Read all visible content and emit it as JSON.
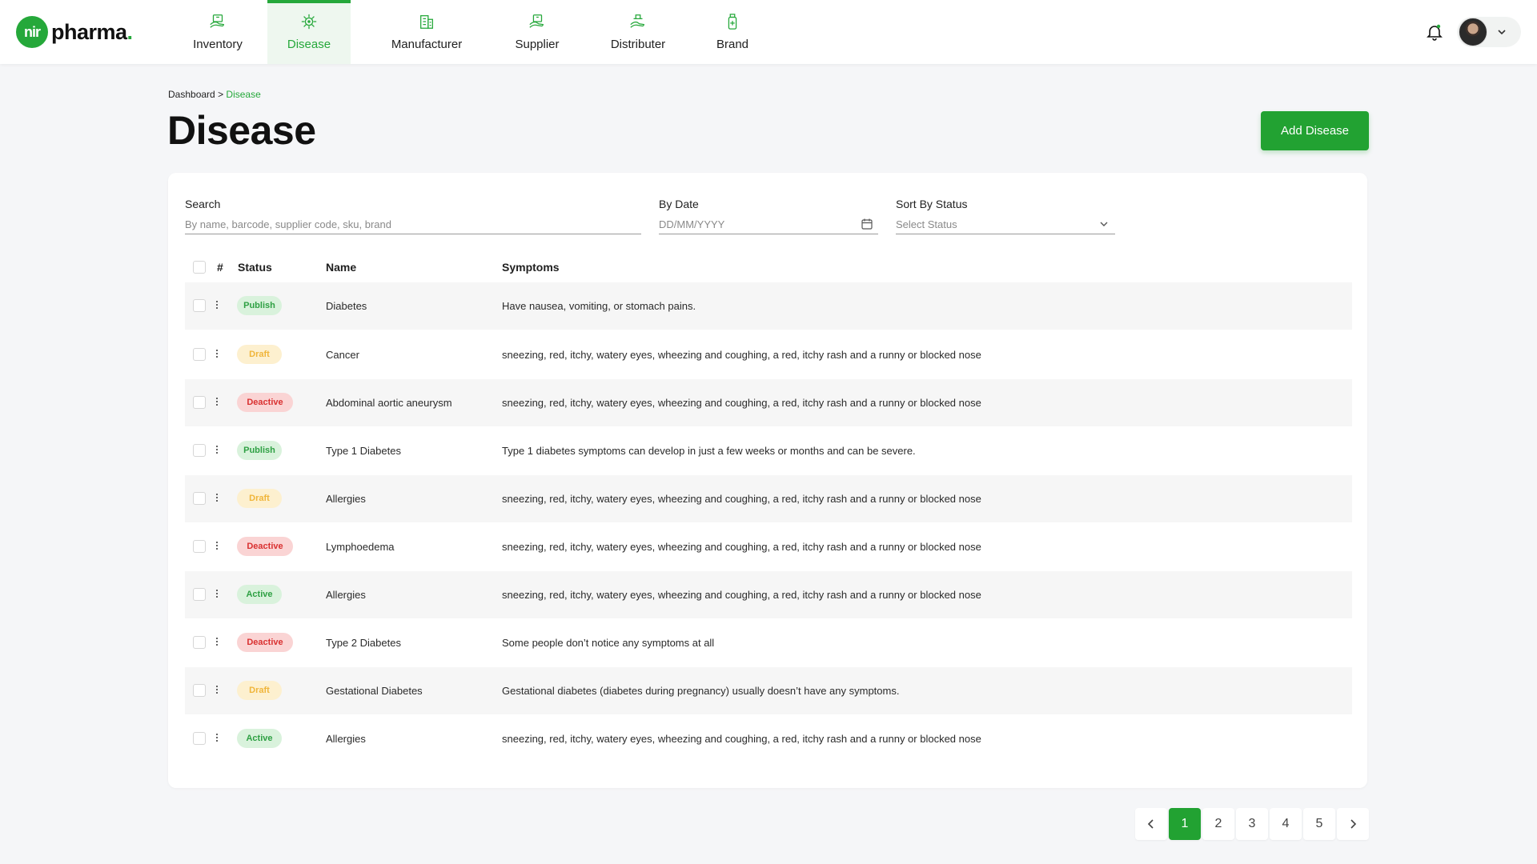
{
  "brand": {
    "badge": "nir",
    "name": "pharma",
    "dot": ".",
    "color": "#25a83a"
  },
  "nav": [
    {
      "label": "Inventory",
      "icon": "inventory-icon",
      "active": false
    },
    {
      "label": "Disease",
      "icon": "disease-icon",
      "active": true
    },
    {
      "label": "Manufacturer",
      "icon": "manufacturer-icon",
      "active": false
    },
    {
      "label": "Supplier",
      "icon": "supplier-icon",
      "active": false
    },
    {
      "label": "Distributer",
      "icon": "distributer-icon",
      "active": false
    },
    {
      "label": "Brand",
      "icon": "brand-icon",
      "active": false
    }
  ],
  "breadcrumb": {
    "root": "Dashboard",
    "sep": ">",
    "current": "Disease"
  },
  "page": {
    "title": "Disease",
    "add_button": "Add Disease"
  },
  "filters": {
    "search": {
      "label": "Search",
      "placeholder": "By name, barcode, supplier code, sku, brand"
    },
    "date": {
      "label": "By Date",
      "placeholder": "DD/MM/YYYY"
    },
    "status": {
      "label": "Sort By Status",
      "placeholder": "Select Status"
    }
  },
  "table": {
    "columns": {
      "hash": "#",
      "status": "Status",
      "name": "Name",
      "symptoms": "Symptoms"
    },
    "rows": [
      {
        "status": "Publish",
        "name": "Diabetes",
        "symptoms": "Have nausea, vomiting, or stomach pains."
      },
      {
        "status": "Draft",
        "name": "Cancer",
        "symptoms": "sneezing, red, itchy, watery eyes, wheezing and coughing, a red, itchy rash and a runny or blocked nose"
      },
      {
        "status": "Deactive",
        "name": "Abdominal aortic aneurysm",
        "symptoms": "sneezing, red, itchy, watery eyes, wheezing and coughing, a red, itchy rash and a runny or blocked nose"
      },
      {
        "status": "Publish",
        "name": "Type 1 Diabetes",
        "symptoms": "Type 1 diabetes symptoms can develop in just a few weeks or months and can be severe."
      },
      {
        "status": "Draft",
        "name": "Allergies",
        "symptoms": "sneezing, red, itchy, watery eyes, wheezing and coughing, a red, itchy rash and a runny or blocked nose"
      },
      {
        "status": "Deactive",
        "name": "Lymphoedema",
        "symptoms": "sneezing, red, itchy, watery eyes, wheezing and coughing, a red, itchy rash and a runny or blocked nose"
      },
      {
        "status": "Active",
        "name": "Allergies",
        "symptoms": "sneezing, red, itchy, watery eyes, wheezing and coughing, a red, itchy rash and a runny or blocked nose"
      },
      {
        "status": "Deactive",
        "name": "Type 2 Diabetes",
        "symptoms": "Some people don’t notice any symptoms at all"
      },
      {
        "status": "Draft",
        "name": "Gestational Diabetes",
        "symptoms": "Gestational diabetes (diabetes during pregnancy) usually doesn’t have any symptoms."
      },
      {
        "status": "Active",
        "name": "Allergies",
        "symptoms": "sneezing, red, itchy, watery eyes, wheezing and coughing, a red, itchy rash and a runny or blocked nose"
      }
    ]
  },
  "status_colors": {
    "Publish": {
      "bg": "#d9f2dc",
      "fg": "#2ea043"
    },
    "Active": {
      "bg": "#d9f2dc",
      "fg": "#2ea043"
    },
    "Draft": {
      "bg": "#fdf0cf",
      "fg": "#f0b53a"
    },
    "Deactive": {
      "bg": "#fad4d4",
      "fg": "#d93030"
    }
  },
  "pagination": {
    "pages": [
      "1",
      "2",
      "3",
      "4",
      "5"
    ],
    "current": "1"
  }
}
